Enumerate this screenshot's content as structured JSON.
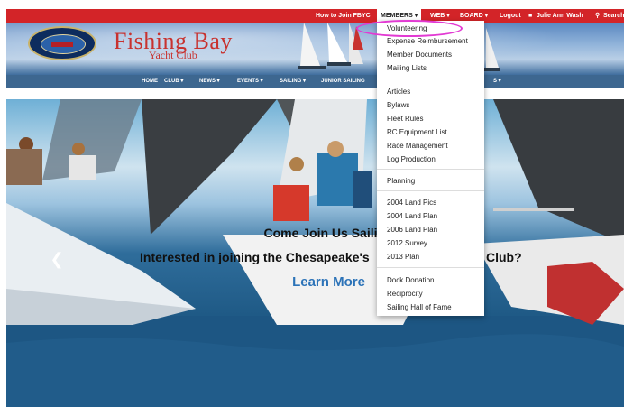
{
  "topbar": {
    "how_to_join": "How to Join FBYC",
    "members": "MEMBERS ▾",
    "web": "WEB ▾",
    "board": "BOARD ▾",
    "logout": "Logout",
    "user": "Julie Ann Wash",
    "search": "Search",
    "colors": {
      "bar": "#d32428"
    }
  },
  "header": {
    "logo_title": "Fishing Bay",
    "logo_sub": "Yacht Club"
  },
  "nav": {
    "items": [
      "HOME",
      "CLUB ▾",
      "NEWS ▾",
      "EVENTS ▾",
      "SAILING ▾",
      "JUNIOR SAILING",
      "S ▾"
    ]
  },
  "members_menu": {
    "groups": [
      [
        "Volunteering",
        "Expense Reimbursement",
        "Member Documents",
        "Mailing Lists"
      ],
      [
        "Articles",
        "Bylaws",
        "Fleet Rules",
        "RC Equipment List",
        "Race Management",
        "Log Production"
      ],
      [
        "Planning"
      ],
      [
        "2004 Land Pics",
        "2004 Land Plan",
        "2006 Land Plan",
        "2012 Survey",
        "2013 Plan"
      ],
      [
        "Dock Donation",
        "Reciprocity",
        "Sailing Hall of Fame"
      ]
    ],
    "highlighted": "Volunteering"
  },
  "hero": {
    "headline": "Come Join Us Saili",
    "subheadline_left": "Interested in joining the Chesapeake's",
    "subheadline_right": "Club?",
    "button": "Learn More",
    "prev_icon": "chevron-left-icon"
  }
}
